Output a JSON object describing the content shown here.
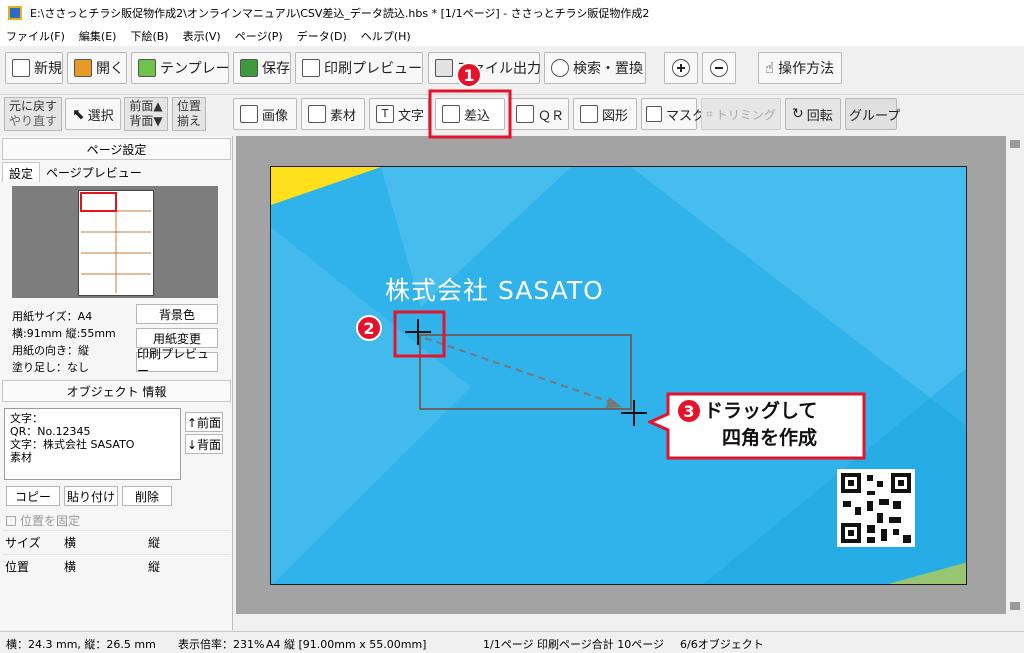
{
  "window": {
    "title": "E:\\ささっとチラシ販促物作成2\\オンラインマニュアル\\CSV差込_データ読込.hbs *  [1/1ページ] - ささっとチラシ販促物作成2"
  },
  "menu": [
    "ファイル(F)",
    "編集(E)",
    "下絵(B)",
    "表示(V)",
    "ページ(P)",
    "データ(D)",
    "ヘルプ(H)"
  ],
  "toolbar1": {
    "new": "新規",
    "open": "開く",
    "template": "テンプレート",
    "save": "保存",
    "print_preview": "印刷プレビュー",
    "file_output": "ファイル出力",
    "search_replace": "検索・置換",
    "help_howto": "操作方法"
  },
  "toolbar2": {
    "undo": "元に戻す",
    "redo": "やり直す",
    "select": "選択",
    "front": "前面▲",
    "back": "背面▼",
    "align_pos_1": "位置",
    "align_pos_2": "揃え",
    "image": "画像",
    "material": "素材",
    "text": "文字",
    "merge": "差込",
    "qr": "ＱＲ",
    "shape": "図形",
    "mask": "マスク",
    "trimming": "トリミング",
    "rotate": "回転",
    "group": "グループ"
  },
  "page_settings": {
    "header": "ページ設定",
    "tabs": [
      "設定",
      "ページプレビュー"
    ],
    "paper_size": "用紙サイズ：A4",
    "dimensions": "横:91mm 縦:55mm",
    "orientation": "用紙の向き：縦",
    "bleed": "塗り足し：なし",
    "btn_bg_color": "背景色",
    "btn_paper_change": "用紙変更",
    "btn_print_preview": "印刷プレビュー"
  },
  "object_info": {
    "header": "オブジェクト 情報",
    "items": [
      "文字：",
      "QR：No.12345",
      "文字：株式会社 SASATO",
      "素材"
    ],
    "btn_front": "↑前面",
    "btn_back": "↓背面",
    "btn_copy": "コピー",
    "btn_paste": "貼り付け",
    "btn_delete": "削除",
    "lock_position": "位置を固定",
    "size_label": "サイズ",
    "position_label": "位置",
    "w_label": "横",
    "h_label": "縦"
  },
  "card": {
    "company": "株式会社 SASATO"
  },
  "callouts": {
    "step1": "1",
    "step2": "2",
    "step3": "3",
    "step3_line1": "ドラッグして",
    "step3_line2": "四角を作成"
  },
  "status": {
    "cursor": "横：24.3 mm, 縦：26.5 mm",
    "zoom": "表示倍率：231%",
    "paper": "A4 縦 [91.00mm x 55.00mm]",
    "pages": "1/1ページ 印刷ページ合計 10ページ",
    "objects": "6/6オブジェクト"
  },
  "colors": {
    "card_blue": "#2fb3ea",
    "accent_yellow": "#ffe01a",
    "callout_red": "#e5122b"
  }
}
